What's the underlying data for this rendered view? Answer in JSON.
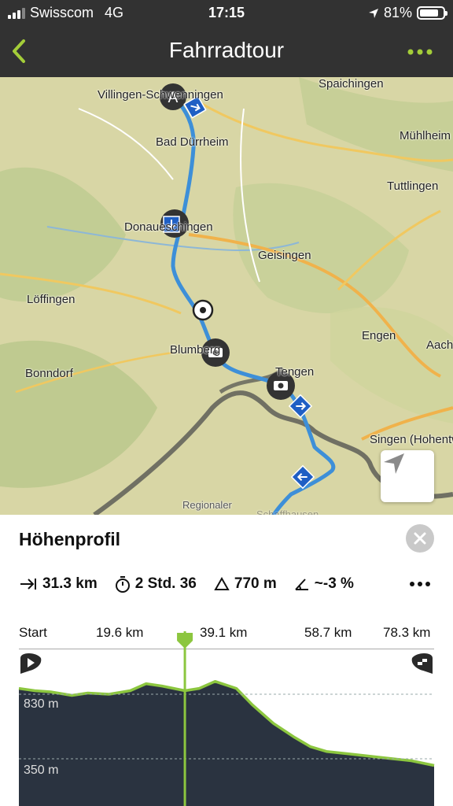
{
  "status_bar": {
    "carrier": "Swisscom",
    "network": "4G",
    "time": "17:15",
    "battery": "81%",
    "battery_level": 0.81
  },
  "navbar": {
    "title": "Fahrradtour",
    "back_icon": "chevron-left-icon",
    "more_icon": "more-dots-icon",
    "accent_color": "#a4cd39"
  },
  "map": {
    "start_marker": "A",
    "places": [
      "Villingen-Schwenningen",
      "Spaichingen",
      "Bad Dürrheim",
      "Mühlheim",
      "Tuttlingen",
      "Donaueschingen",
      "Geisingen",
      "Löffingen",
      "Engen",
      "Aach",
      "Blumberg",
      "Bonndorf",
      "Tengen",
      "Singen (Hohentwiel)",
      "Regionaler",
      "Schaffhausen"
    ],
    "route_color": "#3d8fd8"
  },
  "panel": {
    "title": "Höhenprofil",
    "close_icon": "close-icon",
    "stats": {
      "distance": "31.3 km",
      "duration": "2 Std. 36",
      "ascent": "770 m",
      "slope": "~-3 %"
    },
    "axis_ticks": [
      "Start",
      "19.6 km",
      "39.1 km",
      "58.7 km",
      "78.3 km"
    ],
    "elevation_labels": [
      "830 m",
      "350 m"
    ]
  },
  "profile_data": {
    "type": "area",
    "x_unit": "km",
    "y_unit": "m",
    "x": [
      0,
      3,
      6,
      10,
      13,
      17,
      21,
      24,
      27,
      31.3,
      34,
      37,
      41,
      44,
      48,
      52,
      55,
      58,
      62,
      66,
      70,
      74,
      78.3
    ],
    "y": [
      770,
      760,
      755,
      740,
      750,
      745,
      760,
      790,
      780,
      760,
      770,
      800,
      770,
      700,
      620,
      560,
      520,
      500,
      490,
      480,
      470,
      460,
      440
    ],
    "xlim": [
      0,
      78.3
    ],
    "current_position_km": 31.3,
    "line_color": "#8cc63f",
    "fill_color": "#2a3340"
  }
}
